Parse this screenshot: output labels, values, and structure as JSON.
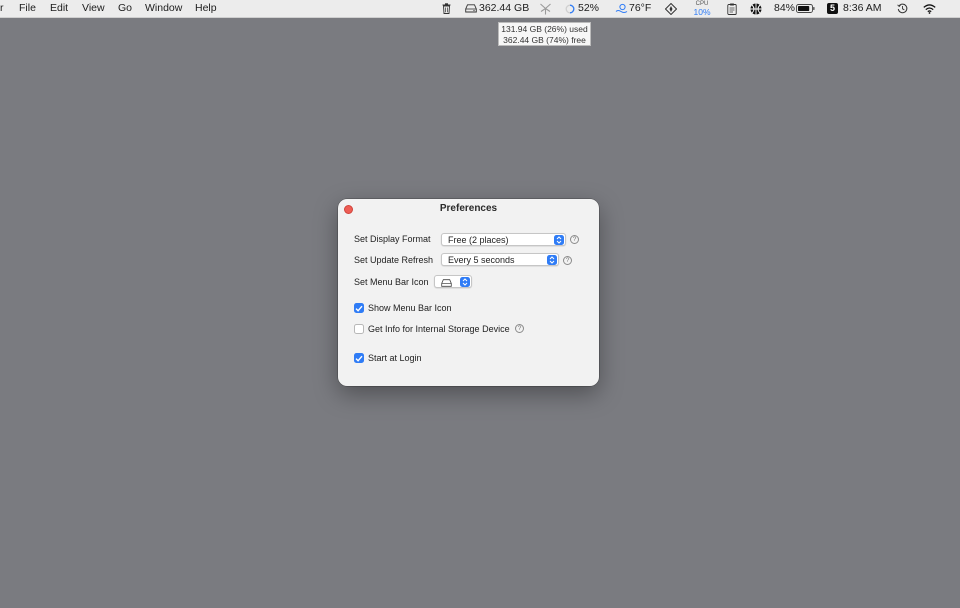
{
  "menubar": {
    "lead_fragment": "r",
    "menus": [
      "File",
      "Edit",
      "View",
      "Go",
      "Window",
      "Help"
    ],
    "status": {
      "disk_free": "362.44 GB",
      "cpu_temp_like": "52%",
      "weather": "76°F",
      "cpu_label": "CPU",
      "cpu_pct": "10%",
      "battery": "84%",
      "badge": "5",
      "clock": "8:36 AM"
    },
    "icons": [
      "trash-icon",
      "drive-icon",
      "radar-icon",
      "progress-ring-icon",
      "weather-icon",
      "compass-icon",
      "clipboard-icon",
      "basketball-icon",
      "battery-icon",
      "time-machine-icon",
      "wifi-icon"
    ]
  },
  "tooltip": {
    "used": "131.94 GB (26%) used",
    "free": "362.44 GB (74%) free"
  },
  "window": {
    "title": "Preferences",
    "display_format_label": "Set Display Format",
    "display_format_value": "Free (2 places)",
    "update_refresh_label": "Set Update Refresh",
    "update_refresh_value": "Every 5 seconds",
    "menu_bar_icon_label": "Set Menu Bar Icon",
    "show_menu_bar_icon": {
      "label": "Show Menu Bar Icon",
      "checked": true
    },
    "internal_storage": {
      "label": "Get Info for Internal Storage Device",
      "checked": false
    },
    "start_at_login": {
      "label": "Start at Login",
      "checked": true
    },
    "help_glyph": "?"
  },
  "colors": {
    "desktop": "#7a7b80",
    "accent": "#2f7cf6",
    "close": "#ee5d55"
  }
}
